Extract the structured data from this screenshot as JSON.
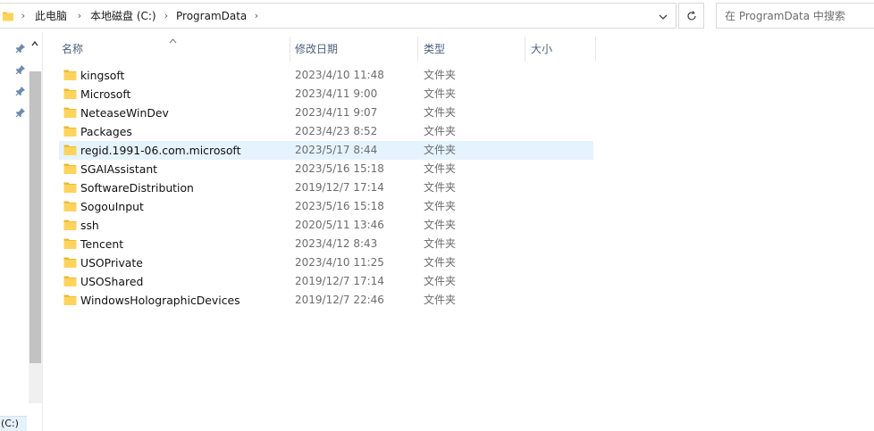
{
  "address_bar": {
    "breadcrumbs": [
      "此电脑",
      "本地磁盘 (C:)",
      "ProgramData"
    ],
    "separator_icon": "chevron-right-icon",
    "dropdown_icon": "chevron-down-icon",
    "refresh_icon": "refresh-icon"
  },
  "search": {
    "placeholder": "在 ProgramData 中搜索"
  },
  "nav_pane": {
    "pins": [
      "pin-icon",
      "pin-icon",
      "pin-icon",
      "pin-icon"
    ],
    "bottom_label": "(C:)"
  },
  "columns": {
    "name": "名称",
    "date": "修改日期",
    "type": "类型",
    "size": "大小",
    "sorted_by": "name"
  },
  "files": [
    {
      "name": "kingsoft",
      "date": "2023/4/10 11:48",
      "type": "文件夹",
      "size": ""
    },
    {
      "name": "Microsoft",
      "date": "2023/4/11 9:00",
      "type": "文件夹",
      "size": ""
    },
    {
      "name": "NeteaseWinDev",
      "date": "2023/4/11 9:07",
      "type": "文件夹",
      "size": ""
    },
    {
      "name": "Packages",
      "date": "2023/4/23 8:52",
      "type": "文件夹",
      "size": ""
    },
    {
      "name": "regid.1991-06.com.microsoft",
      "date": "2023/5/17 8:44",
      "type": "文件夹",
      "size": "",
      "selected": true
    },
    {
      "name": "SGAIAssistant",
      "date": "2023/5/16 15:18",
      "type": "文件夹",
      "size": ""
    },
    {
      "name": "SoftwareDistribution",
      "date": "2019/12/7 17:14",
      "type": "文件夹",
      "size": ""
    },
    {
      "name": "SogouInput",
      "date": "2023/5/16 15:18",
      "type": "文件夹",
      "size": ""
    },
    {
      "name": "ssh",
      "date": "2020/5/11 13:46",
      "type": "文件夹",
      "size": ""
    },
    {
      "name": "Tencent",
      "date": "2023/4/12 8:43",
      "type": "文件夹",
      "size": ""
    },
    {
      "name": "USOPrivate",
      "date": "2023/4/10 11:25",
      "type": "文件夹",
      "size": ""
    },
    {
      "name": "USOShared",
      "date": "2019/12/7 17:14",
      "type": "文件夹",
      "size": ""
    },
    {
      "name": "WindowsHolographicDevices",
      "date": "2019/12/7 22:46",
      "type": "文件夹",
      "size": ""
    }
  ],
  "colors": {
    "selection": "#e5f3ff",
    "folder": "#ffd35c",
    "header_text": "#4c607a",
    "secondary_text": "#6d6d6d"
  }
}
